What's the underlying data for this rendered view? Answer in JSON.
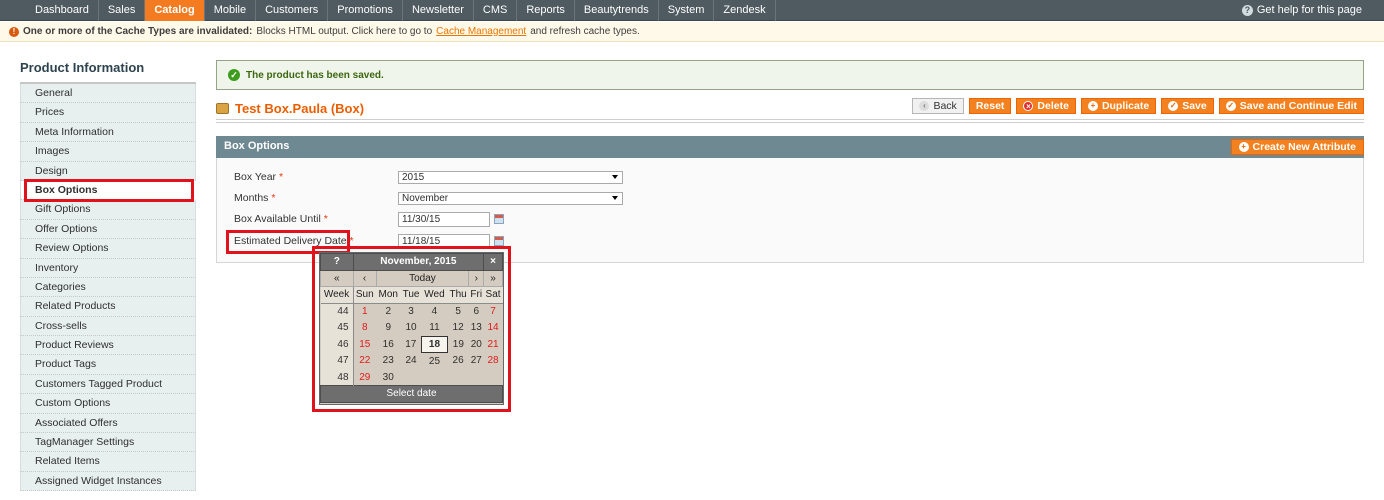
{
  "nav": {
    "items": [
      "Dashboard",
      "Sales",
      "Catalog",
      "Mobile",
      "Customers",
      "Promotions",
      "Newsletter",
      "CMS",
      "Reports",
      "Beautytrends",
      "System",
      "Zendesk"
    ],
    "active": "Catalog",
    "help": "Get help for this page"
  },
  "notice": {
    "bold": "One or more of the Cache Types are invalidated:",
    "text": "Blocks HTML output. Click here to go to",
    "link": "Cache Management",
    "tail": "and refresh cache types."
  },
  "sidebar": {
    "title": "Product Information",
    "tabs": [
      "General",
      "Prices",
      "Meta Information",
      "Images",
      "Design",
      "Box Options",
      "Gift Options",
      "Offer Options",
      "Review Options",
      "Inventory",
      "Categories",
      "Related Products",
      "Cross-sells",
      "Product Reviews",
      "Product Tags",
      "Customers Tagged Product",
      "Custom Options",
      "Associated Offers",
      "TagManager Settings",
      "Related Items",
      "Assigned Widget Instances"
    ],
    "active": "Box Options"
  },
  "message": "The product has been saved.",
  "product": {
    "title": "Test Box.Paula (Box)",
    "buttons": {
      "back": "Back",
      "reset": "Reset",
      "delete": "Delete",
      "duplicate": "Duplicate",
      "save": "Save",
      "save_continue": "Save and Continue Edit"
    }
  },
  "box_options": {
    "title": "Box Options",
    "create_attribute": "Create New Attribute",
    "fields": {
      "year_label": "Box Year",
      "year_value": "2015",
      "months_label": "Months",
      "months_value": "November",
      "available_label": "Box Available Until",
      "available_value": "11/30/15",
      "delivery_label": "Estimated Delivery Date",
      "delivery_value": "11/18/15"
    },
    "required_mark": "*"
  },
  "calendar": {
    "help": "?",
    "month_title": "November, 2015",
    "close": "×",
    "prev_year": "«",
    "prev_month": "‹",
    "today": "Today",
    "next_month": "›",
    "next_year": "»",
    "week_header": "Week",
    "days": [
      "Sun",
      "Mon",
      "Tue",
      "Wed",
      "Thu",
      "Fri",
      "Sat"
    ],
    "weeks": [
      {
        "num": "44",
        "days": [
          "1",
          "2",
          "3",
          "4",
          "5",
          "6",
          "7"
        ]
      },
      {
        "num": "45",
        "days": [
          "8",
          "9",
          "10",
          "11",
          "12",
          "13",
          "14"
        ]
      },
      {
        "num": "46",
        "days": [
          "15",
          "16",
          "17",
          "18",
          "19",
          "20",
          "21"
        ]
      },
      {
        "num": "47",
        "days": [
          "22",
          "23",
          "24",
          "25",
          "26",
          "27",
          "28"
        ]
      },
      {
        "num": "48",
        "days": [
          "29",
          "30",
          "",
          "",
          "",
          "",
          ""
        ]
      }
    ],
    "selected": "18",
    "footer": "Select date"
  }
}
